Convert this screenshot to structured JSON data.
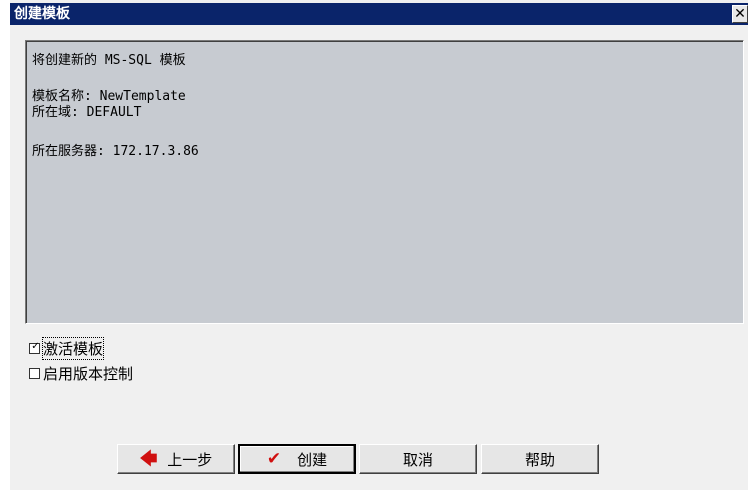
{
  "window": {
    "title": "创建模板",
    "close_glyph": "✕"
  },
  "summary": {
    "heading": "将创建新的 MS-SQL 模板",
    "template_name": "模板名称: NewTemplate",
    "domain": "所在域: DEFAULT",
    "server": "所在服务器: 172.17.3.86"
  },
  "options": {
    "activate": {
      "label": "激活模板",
      "checked": true,
      "check_glyph": "✓"
    },
    "version_control": {
      "label": "启用版本控制",
      "checked": false
    }
  },
  "buttons": {
    "back": {
      "label": "上一步",
      "icon": "arrow-left-icon",
      "glyph": "🡄"
    },
    "create": {
      "label": "创建",
      "icon": "checkmark-icon",
      "glyph": "✔"
    },
    "cancel": {
      "label": "取消"
    },
    "help": {
      "label": "帮助"
    }
  },
  "colors": {
    "titlebar": "#0a246a",
    "panel": "#c7cbd1",
    "icon_red": "#d01010"
  }
}
